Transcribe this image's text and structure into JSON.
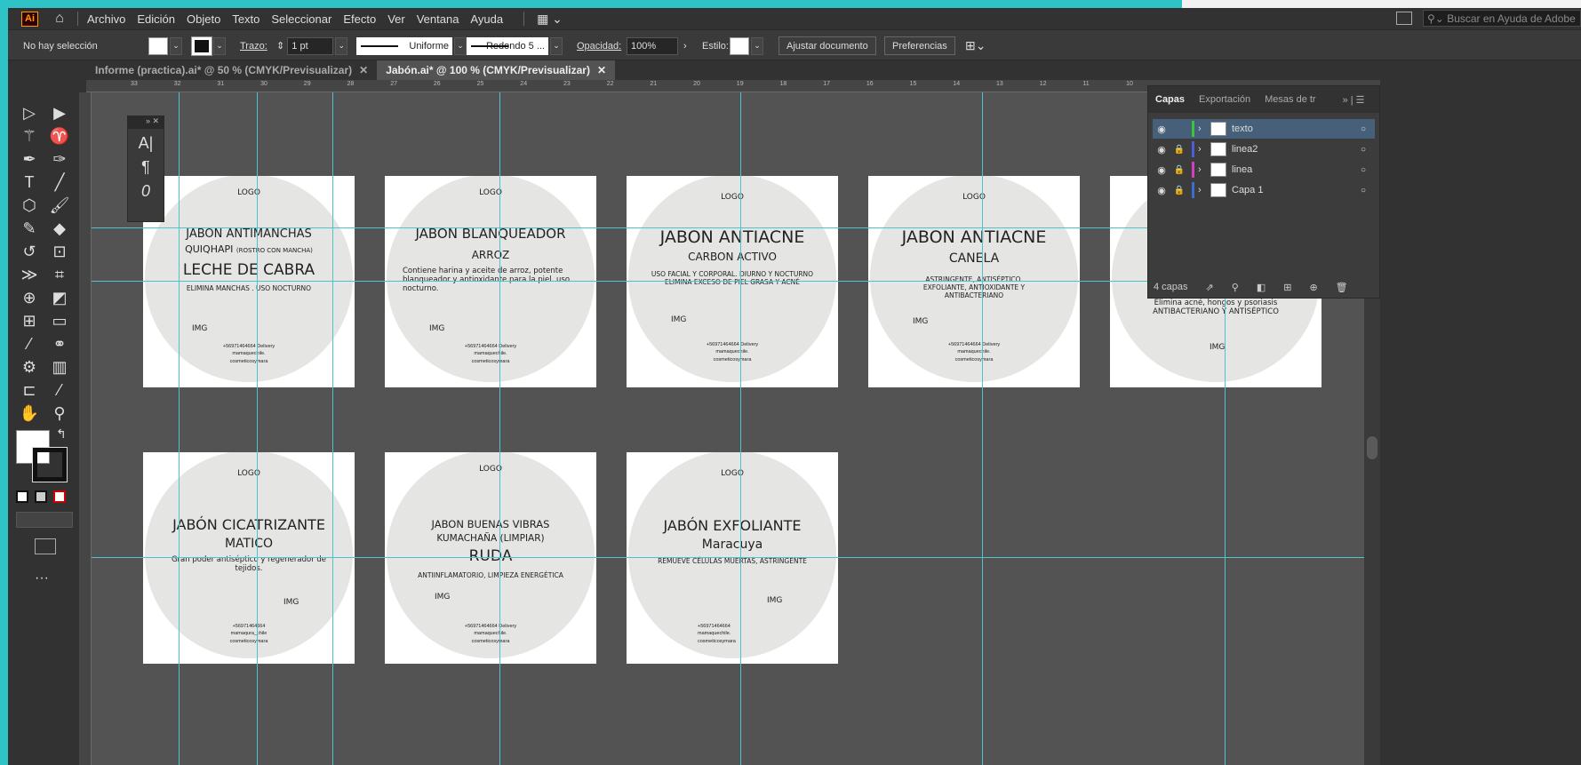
{
  "menu": {
    "items": [
      "Archivo",
      "Edición",
      "Objeto",
      "Texto",
      "Seleccionar",
      "Efecto",
      "Ver",
      "Ventana",
      "Ayuda"
    ],
    "app_logo": "Ai",
    "help_placeholder": "Buscar en Ayuda de Adobe"
  },
  "control": {
    "selection": "No hay selección",
    "stroke_label": "Trazo:",
    "stroke_value": "1 pt",
    "line_style": "Uniforme",
    "brush": "Redondo 5 ...",
    "opacity_label": "Opacidad:",
    "opacity_value": "100%",
    "style_label": "Estilo:",
    "doc_setup": "Ajustar documento",
    "preferences": "Preferencias"
  },
  "tabs": [
    {
      "label": "Informe (practica).ai* @ 50 % (CMYK/Previsualizar)"
    },
    {
      "label": "Jabón.ai* @ 100 % (CMYK/Previsualizar)"
    }
  ],
  "ruler_h": [
    "33",
    "32",
    "31",
    "30",
    "29",
    "28",
    "27",
    "26",
    "25",
    "24",
    "23",
    "22",
    "21",
    "20",
    "19",
    "18",
    "17",
    "16",
    "15",
    "14",
    "13",
    "12",
    "11",
    "10"
  ],
  "layers": {
    "tabs": [
      "Capas",
      "Exportación",
      "Mesas de tr"
    ],
    "items": [
      {
        "name": "texto",
        "color": "#3cc43c"
      },
      {
        "name": "linea2",
        "color": "#4a5fd6"
      },
      {
        "name": "linea",
        "color": "#d040c0"
      },
      {
        "name": "Capa 1",
        "color": "#3a6fd0"
      }
    ],
    "count": "4 capas"
  },
  "artboards": [
    {
      "logo": "LOGO",
      "title": "JABON ANTIMANCHAS",
      "sub": "QUIQHAPI",
      "sub_small": "(ROSTRO CON MANCHA)",
      "main": "LECHE DE CABRA",
      "desc": "ELIMINA MANCHAS . USO NOCTURNO",
      "img": "IMG",
      "contact": [
        "+56971464664 Delivery",
        "mamaquechile.",
        "cosmeticosymara"
      ]
    },
    {
      "logo": "LOGO",
      "title": "JABON BLANQUEADOR",
      "main": "ARROZ",
      "desc": "Contiene harina y aceite de arroz, potente blanqueador y antioxidante para la piel. uso nocturno.",
      "img": "IMG",
      "contact": [
        "+56971464664 Delivery",
        "mamaquechile.",
        "cosmeticosymara"
      ]
    },
    {
      "logo": "LOGO",
      "title": "JABON ANTIACNE",
      "main": "CARBON ACTIVO",
      "desc": "USO FACIAL Y CORPORAL. DIURNO Y NOCTURNO ELIMINA EXCESO DE PIEL GRASA Y ACNÉ",
      "img": "IMG",
      "contact": [
        "+56971464664 Delivery",
        "mamaquechile.",
        "cosmeticosymara"
      ]
    },
    {
      "logo": "LOGO",
      "title": "JABON ANTIACNE",
      "main": "CANELA",
      "desc": "ASTRINGENTE, ANTISÉPTICO. EXFOLIANTE, ANTIOXIDANTE Y ANTIBACTERIANO",
      "img": "IMG",
      "contact": [
        "+56971464664 Delivery",
        "mamaquechile.",
        "cosmeticosymara"
      ]
    },
    {
      "desc": "Elimina acné, hongos y psoriasis ANTIBACTERIANO Y ANTISÉPTICO",
      "img": "IMG"
    },
    {
      "logo": "LOGO",
      "title": "JABÓN CICATRIZANTE",
      "main": "MATICO",
      "desc": "Gran poder antiséptico y regenerador de tejidos.",
      "img": "IMG",
      "contact": [
        "+56971464664",
        "mamaqura_chile",
        "cosmeticosymara"
      ]
    },
    {
      "logo": "LOGO",
      "title": "JABON BUENAS VIBRAS",
      "sub": "KUMACHAÑA (LIMPIAR)",
      "main": "RUDA",
      "desc": "ANTIINFLAMATORIO, LIMPIEZA ENERGÉTICA",
      "img": "IMG",
      "contact": [
        "+56971464664 Delivery",
        "mamaquechile.",
        "cosmeticosymara"
      ]
    },
    {
      "logo": "LOGO",
      "title": "JABÓN EXFOLIANTE",
      "main": "Maracuya",
      "desc": "REMUEVE CÉLULAS MUERTAS, ASTRINGENTE",
      "img": "IMG",
      "contact": [
        "+56971464664",
        "mamaquechile.",
        "cosmeticosymara"
      ]
    }
  ]
}
